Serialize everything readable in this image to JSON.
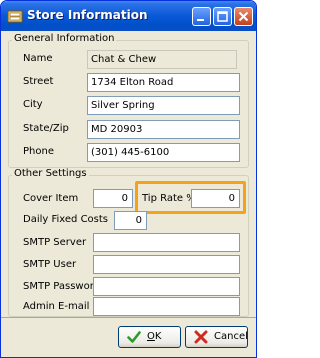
{
  "window": {
    "title": "Store Information",
    "colors": {
      "title_bar": "#0a58d8",
      "highlight": "#f5a11c"
    }
  },
  "general": {
    "group_label": "General Information",
    "name_label": "Name",
    "name_value": "Chat & Chew",
    "street_label": "Street",
    "street_value": "1734 Elton Road",
    "city_label": "City",
    "city_value": "Silver Spring",
    "statezip_label": "State/Zip",
    "statezip_value": "MD 20903",
    "phone_label": "Phone",
    "phone_value": "(301) 445-6100"
  },
  "other": {
    "group_label": "Other Settings",
    "cover_item_label": "Cover Item",
    "cover_item_value": "0",
    "tip_rate_label": "Tip Rate %",
    "tip_rate_value": "0",
    "daily_fixed_costs_label": "Daily Fixed Costs",
    "daily_fixed_costs_value": "0",
    "smtp_server_label": "SMTP Server",
    "smtp_server_value": "",
    "smtp_user_label": "SMTP User",
    "smtp_user_value": "",
    "smtp_password_label": "SMTP Password",
    "smtp_password_value": "",
    "admin_email_label": "Admin E-mail",
    "admin_email_value": ""
  },
  "buttons": {
    "ok_first": "O",
    "ok_rest": "K",
    "cancel_label": "Cancel"
  }
}
